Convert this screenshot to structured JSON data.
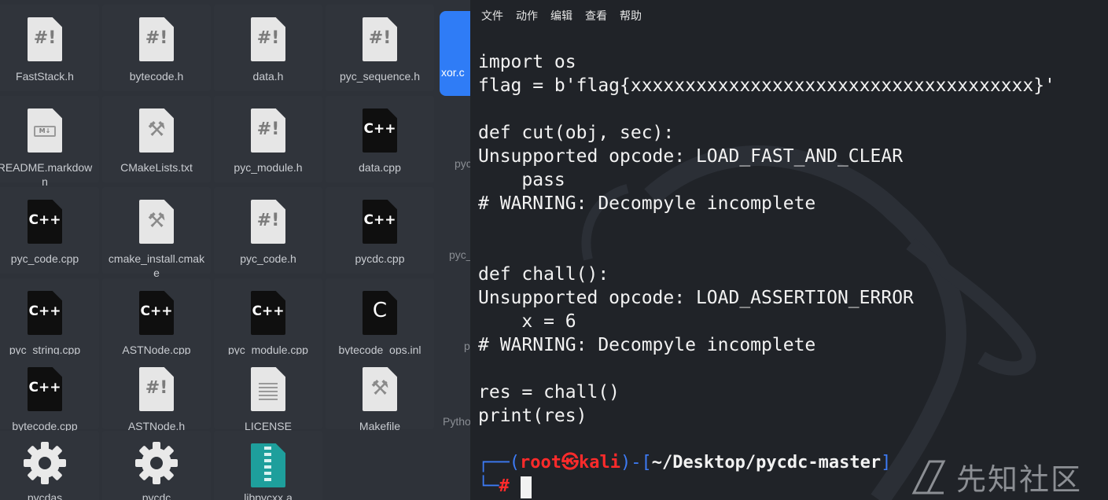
{
  "file_manager": {
    "tiles": [
      {
        "name": "FastStack.h",
        "icon": "header-file-icon"
      },
      {
        "name": "bytecode.h",
        "icon": "header-file-icon"
      },
      {
        "name": "data.h",
        "icon": "header-file-icon"
      },
      {
        "name": "pyc_sequence.h",
        "icon": "header-file-icon"
      },
      {
        "name": "README.markdow\nn",
        "icon": "markdown-file-icon"
      },
      {
        "name": "CMakeLists.txt",
        "icon": "build-file-icon"
      },
      {
        "name": "pyc_module.h",
        "icon": "header-file-icon"
      },
      {
        "name": "data.cpp",
        "icon": "cpp-file-icon"
      },
      {
        "name": "pyc_code.cpp",
        "icon": "cpp-file-icon"
      },
      {
        "name": "cmake_install.cmak\ne",
        "icon": "build-file-icon"
      },
      {
        "name": "pyc_code.h",
        "icon": "header-file-icon"
      },
      {
        "name": "pycdc.cpp",
        "icon": "cpp-file-icon"
      },
      {
        "name": "pyc_string.cpp",
        "icon": "cpp-file-icon"
      },
      {
        "name": "ASTNode.cpp",
        "icon": "cpp-file-icon"
      },
      {
        "name": "pyc_module.cpp",
        "icon": "cpp-file-icon"
      },
      {
        "name": "bytecode_ops.inl",
        "icon": "c-file-icon"
      },
      {
        "name": "bytecode.cpp",
        "icon": "cpp-file-icon"
      },
      {
        "name": "ASTNode.h",
        "icon": "header-file-icon"
      },
      {
        "name": "LICENSE",
        "icon": "text-file-icon"
      },
      {
        "name": "Makefile",
        "icon": "build-file-icon"
      },
      {
        "name": "pycdas",
        "icon": "executable-gear-icon"
      },
      {
        "name": "pycdc",
        "icon": "executable-gear-icon"
      },
      {
        "name": "libpycxx.a",
        "icon": "archive-file-icon"
      }
    ],
    "partial": {
      "xor": "xor.c",
      "pyc1": "pyc",
      "pyc_numeric": "pyc_numeric.cpp",
      "p": "p",
      "python": "Pytho"
    }
  },
  "terminal": {
    "menu": [
      "文件",
      "动作",
      "编辑",
      "查看",
      "帮助"
    ],
    "code": "import os\nflag = b'flag{xxxxxxxxxxxxxxxxxxxxxxxxxxxxxxxxxxxxx}'\n\ndef cut(obj, sec):\nUnsupported opcode: LOAD_FAST_AND_CLEAR\n    pass\n# WARNING: Decompyle incomplete\n\n\ndef chall():\nUnsupported opcode: LOAD_ASSERTION_ERROR\n    x = 6\n# WARNING: Decompyle incomplete\n\nres = chall()\nprint(res)",
    "prompt": {
      "open": "┌──(",
      "user": "root㉿kali",
      "mid": ")-[",
      "path": "~/Desktop/pycdc-master",
      "close": "]",
      "second_line": "└─",
      "hash": "#"
    }
  },
  "watermark": {
    "text": "先知社区"
  },
  "colors": {
    "accent_blue": "#2f7cf6",
    "prompt_red": "#ff2b2b",
    "prompt_blue": "#3d7bf6",
    "terminal_bg": "#202328"
  }
}
